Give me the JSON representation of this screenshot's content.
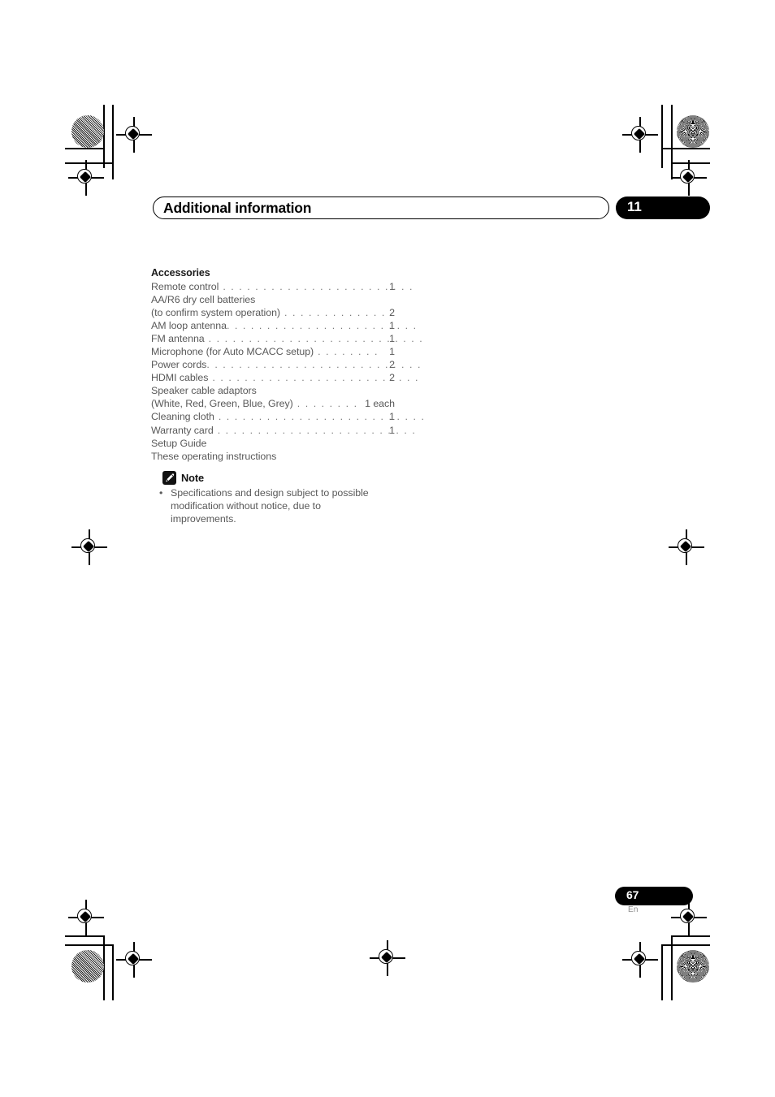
{
  "header": {
    "chapter_title": "Additional information",
    "chapter_number": "11"
  },
  "main": {
    "section_heading": "Accessories",
    "accessories": [
      {
        "label": "Remote control",
        "leader": " . . . . . . . . . . . . . . . . . . . . . . . .",
        "qty": "1"
      },
      {
        "label": "AA/R6 dry cell batteries",
        "leader": "",
        "qty": ""
      },
      {
        "label": "(to confirm system operation)",
        "leader": " . . . . . . . . . . . . . .",
        "qty": "2"
      },
      {
        "label": "AM loop antenna",
        "leader": ". . . . . . . . . . . . . . . . . . . . . . . .",
        "qty": "1"
      },
      {
        "label": "FM antenna",
        "leader": " . . . . . . . . . . . . . . . . . . . . . . . . . . .",
        "qty": "1"
      },
      {
        "label": "Microphone (for Auto MCACC setup)",
        "leader": " . . . . . . . .",
        "qty": "1"
      },
      {
        "label": "Power cords",
        "leader": ". . . . . . . . . . . . . . . . . . . . . . . . . . .",
        "qty": "2"
      },
      {
        "label": "HDMI cables",
        "leader": " . . . . . . . . . . . . . . . . . . . . . . . . . .",
        "qty": "2"
      },
      {
        "label": "Speaker cable adaptors",
        "leader": "",
        "qty": ""
      },
      {
        "label": "(White, Red, Green, Blue, Grey)",
        "leader": " . . . . . . . .",
        "qty": "1 each"
      },
      {
        "label": "Cleaning cloth",
        "leader": " . . . . . . . . . . . . . . . . . . . . . . . . . .",
        "qty": "1"
      },
      {
        "label": "Warranty card",
        "leader": " . . . . . . . . . . . . . . . . . . . . . . . . .",
        "qty": "1"
      },
      {
        "label": "Setup Guide",
        "leader": "",
        "qty": ""
      },
      {
        "label": "These operating instructions",
        "leader": "",
        "qty": ""
      }
    ],
    "note": {
      "icon": "pencil-note-icon",
      "title": "Note",
      "bullet_char": "•",
      "items": [
        "Specifications and design subject to possible modification without notice, due to improvements."
      ]
    }
  },
  "footer": {
    "page_number": "67",
    "language_code": "En"
  },
  "colors": {
    "ink_black": "#000000",
    "body_gray": "#595959",
    "heading_dark": "#1a1a1a",
    "lang_gray": "#8d8d8d"
  }
}
